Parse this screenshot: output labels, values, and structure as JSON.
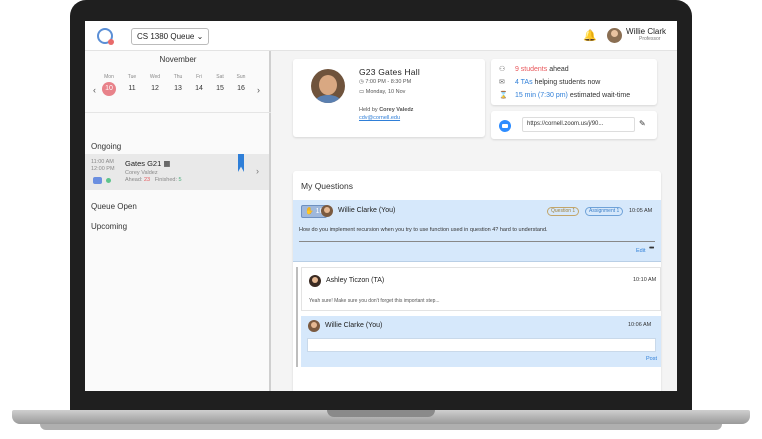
{
  "topbar": {
    "course": "CS 1380 Queue",
    "user_name": "Willie Clark",
    "user_role": "Professor"
  },
  "calendar": {
    "month": "November",
    "prev": "‹",
    "next": "›",
    "days": [
      {
        "dow": "Mon",
        "num": "10",
        "selected": true
      },
      {
        "dow": "Tue",
        "num": "11"
      },
      {
        "dow": "Wed",
        "num": "12"
      },
      {
        "dow": "Thu",
        "num": "13"
      },
      {
        "dow": "Fri",
        "num": "14"
      },
      {
        "dow": "Sat",
        "num": "15"
      },
      {
        "dow": "Sun",
        "num": "16"
      }
    ]
  },
  "sidebar": {
    "ongoing_label": "Ongoing",
    "queue_open_label": "Queue Open",
    "upcoming_label": "Upcoming",
    "queue_item": {
      "start": "11:00 AM",
      "end": "12:00 PM",
      "title": "Gates G21",
      "ta": "Corey Valdez",
      "ahead_label": "Ahead:",
      "ahead": "23",
      "finished_label": "Finished:",
      "finished": "5"
    }
  },
  "office_hours": {
    "room": "G23 Gates Hall",
    "time": "7:00 PM - 8:30 PM",
    "date": "Monday, 10 Nov",
    "held_by_label": "Held by",
    "held_by": "Corey Valedz",
    "email": "cdv@cornell.edu"
  },
  "stats": {
    "students": "9 students",
    "students_suffix": "ahead",
    "tas": "4 TAs",
    "tas_suffix": "helping students now",
    "wait_min": "15 min",
    "wait_time": "(7:30 pm)",
    "wait_suffix": "estimated wait-time"
  },
  "zoom": {
    "link": "https://cornell.zoom.us/j/90..."
  },
  "my_questions": {
    "title": "My Questions",
    "question": {
      "number": "10",
      "author": "Willie Clarke (You)",
      "tag_question": "Question 1",
      "tag_assignment": "Assignment 1",
      "time": "10:05 AM",
      "text": "How do you implement recursion when you try to use function used in question 4? hard to understand.",
      "edit": "Edit",
      "more": "•••"
    },
    "reply": {
      "author": "Ashley Ticzon (TA)",
      "time": "10:10 AM",
      "text": "Yeah sure! Make sure you don't forget this important step..."
    },
    "compose": {
      "author": "Willie Clarke (You)",
      "time": "10:06 AM",
      "post": "Post"
    }
  }
}
